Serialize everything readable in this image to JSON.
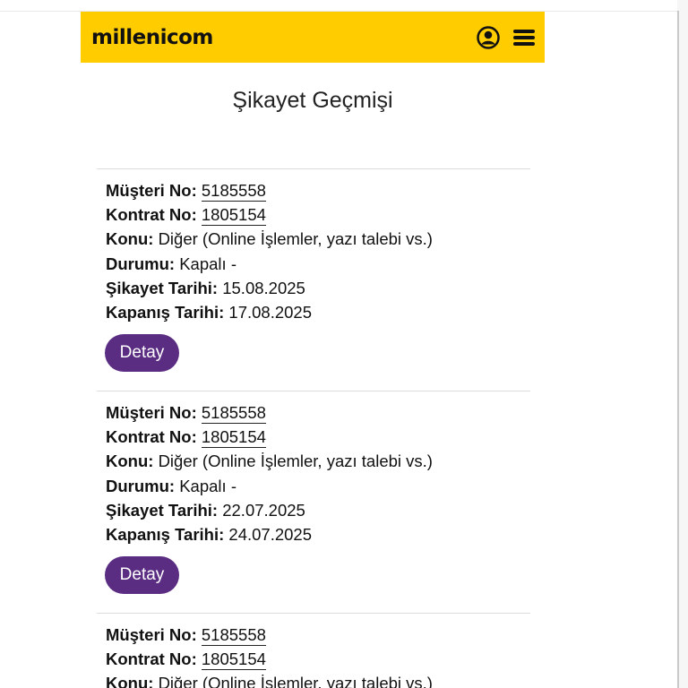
{
  "header": {
    "logo": "millenicom",
    "brand_color": "#ffcc00",
    "icons": [
      "user-account-icon",
      "menu-icon"
    ]
  },
  "page_title": "Şikayet Geçmişi",
  "labels": {
    "customer_no": "Müşteri No:",
    "contract_no": "Kontrat No:",
    "subject": "Konu:",
    "status": "Durumu:",
    "complaint_date": "Şikayet Tarihi:",
    "close_date": "Kapanış Tarihi:"
  },
  "button_color": "#5a2d82",
  "complaints": [
    {
      "customer_no": "5185558",
      "contract_no": "1805154",
      "subject": "Diğer (Online İşlemler, yazı talebi vs.)",
      "status": "Kapalı -",
      "complaint_date": "15.08.2025",
      "close_date": "17.08.2025",
      "detail_label": "Detay"
    },
    {
      "customer_no": "5185558",
      "contract_no": "1805154",
      "subject": "Diğer (Online İşlemler, yazı talebi vs.)",
      "status": "Kapalı -",
      "complaint_date": "22.07.2025",
      "close_date": "24.07.2025",
      "detail_label": "Detay"
    },
    {
      "customer_no": "5185558",
      "contract_no": "1805154",
      "subject": "Diğer (Online İşlemler, yazı talebi vs.)"
    }
  ]
}
